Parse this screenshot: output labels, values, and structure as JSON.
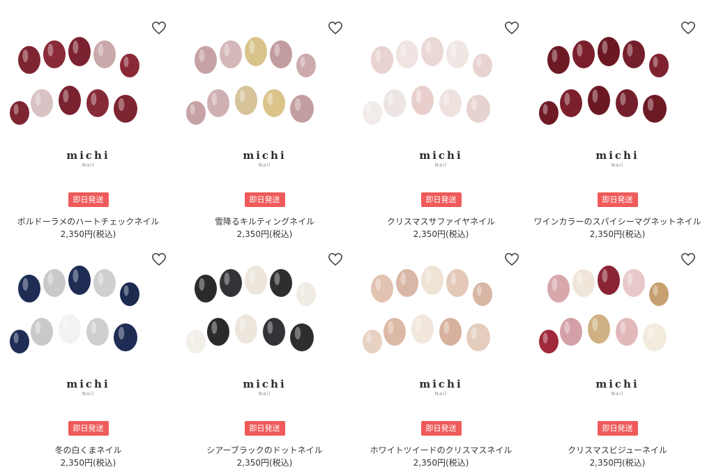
{
  "brand": {
    "name": "michi",
    "sub": "Nail"
  },
  "badge_label": "即日発送",
  "products": [
    {
      "name": "ボルドーラメのハートチェックネイル",
      "price": "2,350円(税込)",
      "nail_colors": [
        "#7e2532",
        "#8a2a38",
        "#7a2230",
        "#c9a9ab",
        "#8b2836",
        "#7e2532",
        "#d8c2c4",
        "#7a2230",
        "#862a37",
        "#7e2532"
      ]
    },
    {
      "name": "雪降るキルティングネイル",
      "price": "2,350円(税込)",
      "nail_colors": [
        "#c7a2a4",
        "#d4b7b8",
        "#d8c38a",
        "#c39c9f",
        "#ccaaac",
        "#c7a2a4",
        "#cfb0b2",
        "#d6c39a",
        "#dcc38a",
        "#c39ea1"
      ]
    },
    {
      "name": "クリスマスサファイヤネイル",
      "price": "2,350円(税込)",
      "nail_colors": [
        "#e8d3d1",
        "#efe4e2",
        "#ead8d4",
        "#f0e6e3",
        "#e8d3d1",
        "#f1ebea",
        "#ece5e4",
        "#e8cfcc",
        "#eee2df",
        "#e6d2cf"
      ]
    },
    {
      "name": "ワインカラーのスパイシーマグネットネイル",
      "price": "2,350円(税込)",
      "nail_colors": [
        "#6e1a25",
        "#7a1f2b",
        "#6b1823",
        "#74202c",
        "#7e2230",
        "#6e1a25",
        "#7a1f2b",
        "#6b1823",
        "#74202c",
        "#6e1a25"
      ]
    },
    {
      "name": "冬の白くまネイル",
      "price": "2,350円(税込)",
      "nail_colors": [
        "#1f2d55",
        "#c9c9cb",
        "#1f2d55",
        "#cfcfd0",
        "#1d2a50",
        "#1f2d55",
        "#c9c9cb",
        "#f2f2f2",
        "#cfcfd0",
        "#1f2d55"
      ]
    },
    {
      "name": "シアーブラックのドットネイル",
      "price": "2,350円(税込)",
      "nail_colors": [
        "#2b2b2e",
        "#333337",
        "#ece6dc",
        "#2e2e31",
        "#f0ebe3",
        "#f3efe9",
        "#2b2b2e",
        "#ece6dc",
        "#333337",
        "#2e2e31"
      ]
    },
    {
      "name": "ホワイトツイードのクリスマスネイル",
      "price": "2,350円(税込)",
      "nail_colors": [
        "#e2c2b0",
        "#d9b7a6",
        "#efe3d6",
        "#e4c8b8",
        "#d9b5a4",
        "#e6d1c2",
        "#dcb9a6",
        "#f1e7dc",
        "#d8b19e",
        "#e4cdbd"
      ]
    },
    {
      "name": "クリスマスビジューネイル",
      "price": "2,350円(税込)",
      "nail_colors": [
        "#d7a7ac",
        "#efe6d9",
        "#8a2434",
        "#e8c8c8",
        "#c7a071",
        "#a02a3b",
        "#d4a0a7",
        "#cfb183",
        "#e3b8bb",
        "#f2ebde"
      ]
    }
  ]
}
